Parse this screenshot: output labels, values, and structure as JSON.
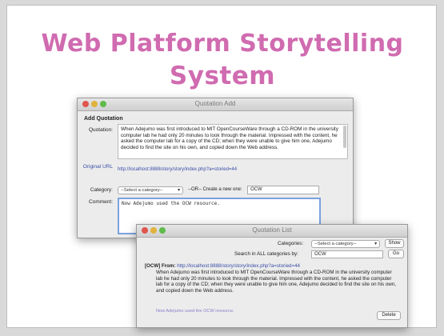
{
  "slide": {
    "title_line1": "Web Platform Storytelling",
    "title_line2": "System"
  },
  "quotation_add": {
    "window_title": "Quotation Add",
    "heading": "Add Quotation",
    "quotation_label": "Quotation:",
    "quotation_text": "When Adejumo was first introduced to MIT OpenCourseWare through a CD-ROM in the university computer lab he had only 20 minutes to look through the material. Impressed with the content, he asked the computer lab for a copy of the CD; when they were unable to give him one, Adejumo decided to find the site on his own, and copied down the Web address.",
    "original_url_label": "Original URL",
    "original_url_value": "http://localhost:8888/story/story/index.php?a=storied=44",
    "category_label": "Category:",
    "category_select": "--Select a category--",
    "or_create_label": "--OR-- Create a new one:",
    "new_category_value": "OCW",
    "comment_label": "Comment:",
    "comment_value": "Now Adejumo used the OCW resource."
  },
  "quotation_list": {
    "window_title": "Quotation List",
    "categories_label": "Categories:",
    "categories_select": "--Select a category--",
    "show_button": "Show",
    "search_label": "Search in ALL categories by:",
    "search_value": "OCW",
    "go_button": "Go",
    "entry_prefix": "[OCW] From:",
    "entry_url": "http://localhost:8888/story/story/index.php?a=storied=44",
    "entry_quote": "When Adejumo was first introduced to MIT OpenCourseWare through a CD-ROM in the university computer lab he had only 20 minutes to look through the material. Impressed with the content, he asked the computer lab for a copy of the CD; when they were unable to give him one, Adejumo decided to find the site on his own, and copied down the Web address.",
    "entry_comment": "Now Adejumo used the OCW resource.",
    "delete_button": "Delete"
  }
}
